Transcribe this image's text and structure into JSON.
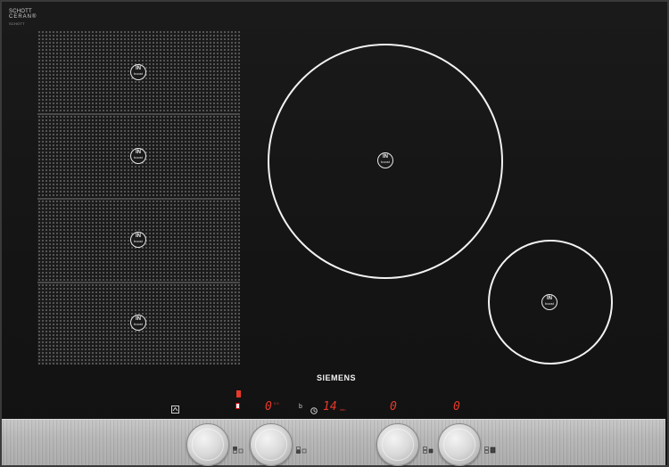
{
  "maker_mark": {
    "line1": "SCHOTT",
    "line2": "CERAN®",
    "line3": "SCHOTT"
  },
  "brand": "SIEMENS",
  "zone_badge": {
    "top": "IN",
    "bottom": "boost"
  },
  "flex_zone": {
    "cells": 4
  },
  "display": {
    "left_digit": "0",
    "left_sup": "0.5",
    "timer_mode": "b",
    "timer_value": "14",
    "timer_unit": "min",
    "zone3_digit": "0",
    "zone4_digit": "0"
  },
  "icons": {
    "lock": "child-lock-icon",
    "clock": "clock-icon",
    "knob_zone": "zone-selector-icon"
  },
  "colors": {
    "display_red": "#e53a2a",
    "glass": "#141414",
    "ring": "#f2f2f2",
    "steel": "#b8b8b8"
  }
}
